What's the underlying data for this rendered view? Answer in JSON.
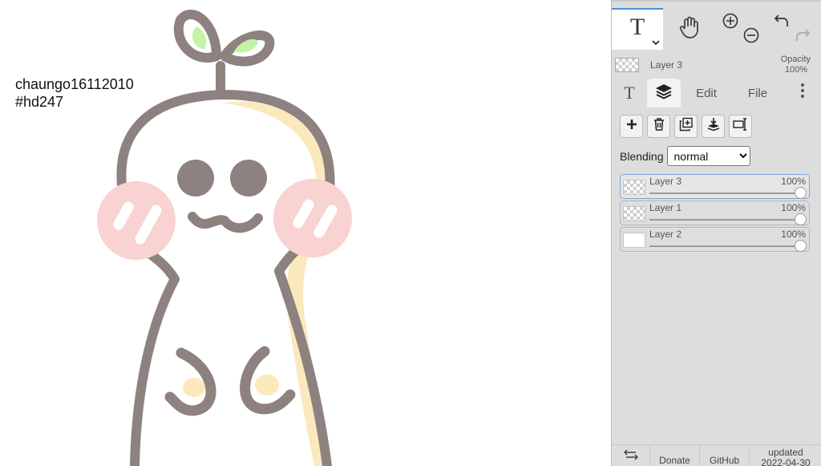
{
  "canvas": {
    "text_line1": "chaungo16112010",
    "text_line2": "#hd247"
  },
  "toolbar": {
    "text_tool_label": "T",
    "text_tool_dropdown_icon": "chevron-down-icon",
    "hand_tool_icon": "hand-icon",
    "zoom_in_icon": "zoom-in-icon",
    "zoom_out_icon": "zoom-out-icon",
    "undo_icon": "undo-icon",
    "redo_icon": "redo-icon"
  },
  "current_layer": {
    "name": "Layer 3",
    "opacity_label": "Opacity",
    "opacity_value": "100%"
  },
  "tabs": {
    "text_tab": "T",
    "layers_tab_icon": "layers-icon",
    "edit": "Edit",
    "file": "File",
    "more_icon": "more-vertical-icon",
    "active": "layers"
  },
  "layer_actions": [
    {
      "name": "add-layer",
      "icon": "plus-icon"
    },
    {
      "name": "delete-layer",
      "icon": "trash-icon"
    },
    {
      "name": "duplicate-layer",
      "icon": "duplicate-icon"
    },
    {
      "name": "merge-down",
      "icon": "merge-down-icon"
    },
    {
      "name": "rename-layer",
      "icon": "rename-icon"
    }
  ],
  "blending": {
    "label": "Blending",
    "value": "normal"
  },
  "layers": [
    {
      "name": "Layer 3",
      "opacity": "100%",
      "selected": true,
      "thumb": "checker"
    },
    {
      "name": "Layer 1",
      "opacity": "100%",
      "selected": false,
      "thumb": "checker"
    },
    {
      "name": "Layer 2",
      "opacity": "100%",
      "selected": false,
      "thumb": "white"
    }
  ],
  "footer": {
    "swap_icon": "swap-horizontal-icon",
    "donate": "Donate",
    "github": "GitHub",
    "updated_label": "updated",
    "updated_date": "2022-04-30"
  },
  "colors": {
    "outline": "#8d8280",
    "cheek": "#f9d2d2",
    "leaf": "#c6f2a8",
    "body_shade": "#fbe9bd",
    "panel_bg": "#dddddd",
    "accent": "#4a90d9"
  }
}
